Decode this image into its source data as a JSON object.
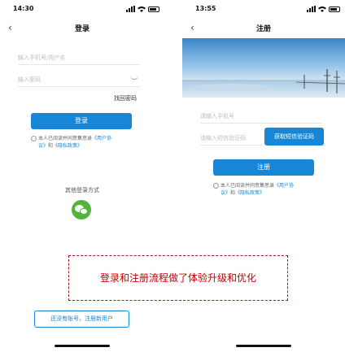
{
  "login_screen": {
    "status_time": "14:30",
    "title": "登录",
    "phone_placeholder": "输入手机号/用户名",
    "password_placeholder": "输入密码",
    "forgot_password": "找回密码",
    "login_button": "登录",
    "agreement_prefix": "本人已阅读并同意集思录",
    "user_agreement": "《用户协议》",
    "and": "和",
    "privacy_policy": "《隐私政策》",
    "other_login": "其他登录方式",
    "register_link": "还没有账号，注册新用户"
  },
  "register_screen": {
    "status_time": "13:55",
    "title": "注册",
    "phone_placeholder": "请输入手机号",
    "sms_placeholder": "请输入短信验证码",
    "sms_button": "获取短信验证码",
    "register_button": "注册",
    "agreement_prefix": "本人已阅读并同意集思录",
    "user_agreement": "《用户协议》",
    "and": "和",
    "privacy_policy": "《隐私政策》"
  },
  "caption": "登录和注册流程做了体验升级和优化",
  "colors": {
    "primary": "#1886d6",
    "wechat": "#53b33b",
    "caption_text": "#c00000",
    "caption_border": "#9b1b1b"
  },
  "icons": [
    "back-chevron-icon",
    "signal-icon",
    "wifi-icon",
    "battery-icon",
    "password-eye-icon",
    "wechat-icon"
  ]
}
